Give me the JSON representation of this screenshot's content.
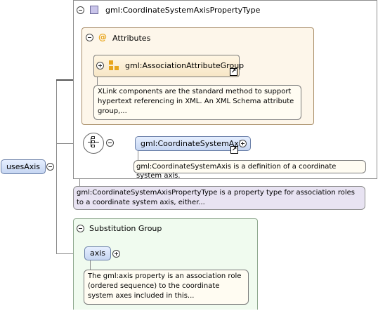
{
  "root_element": {
    "name": "usesAxis"
  },
  "complex_type": {
    "name": "gml:CoordinateSystemAxisPropertyType"
  },
  "attributes": {
    "header": "Attributes",
    "group": {
      "name": "gml:AssociationAttributeGroup",
      "doc": "XLink components are the standard method to support hypertext referencing in XML. An XML Schema attribute group,..."
    }
  },
  "sequence": {
    "child": {
      "name": "gml:CoordinateSystemAxis",
      "doc": "gml:CoordinateSystemAxis is a definition of a coordinate system axis."
    }
  },
  "type_doc": "gml:CoordinateSystemAxisPropertyType is a property type for association roles to a coordinate system axis, either...",
  "substitution_group": {
    "header": "Substitution Group",
    "element": {
      "name": "axis",
      "doc": "The gml:axis property is an association role (ordered sequence) to the coordinate system axes included in this..."
    }
  },
  "icons": {
    "attribute_marker": "at-sign-icon",
    "attribute_marker_glyph": "@",
    "shortcut_glyph": "↗",
    "attribute_color": "#e8a51c",
    "element_color": "#c6d6f2"
  }
}
